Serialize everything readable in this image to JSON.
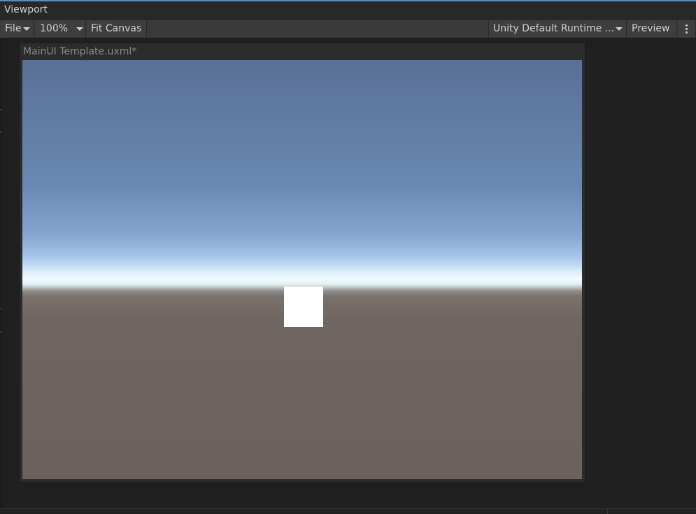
{
  "window": {
    "title": "Viewport"
  },
  "toolbar": {
    "file_label": "File",
    "zoom_value": "100%",
    "fit_canvas_label": "Fit Canvas",
    "theme_value": "Unity Default Runtime ...",
    "preview_label": "Preview"
  },
  "canvas": {
    "document_title": "MainUI Template.uxml*"
  },
  "colors": {
    "accent": "#4a90d9",
    "sky_top": "#5a6f95",
    "horizon": "#f2fbfd",
    "ground": "#6c625d",
    "cube": "#ffffff"
  },
  "icons": {
    "dropdown": "chevron-down-icon",
    "more": "more-vertical-icon"
  }
}
